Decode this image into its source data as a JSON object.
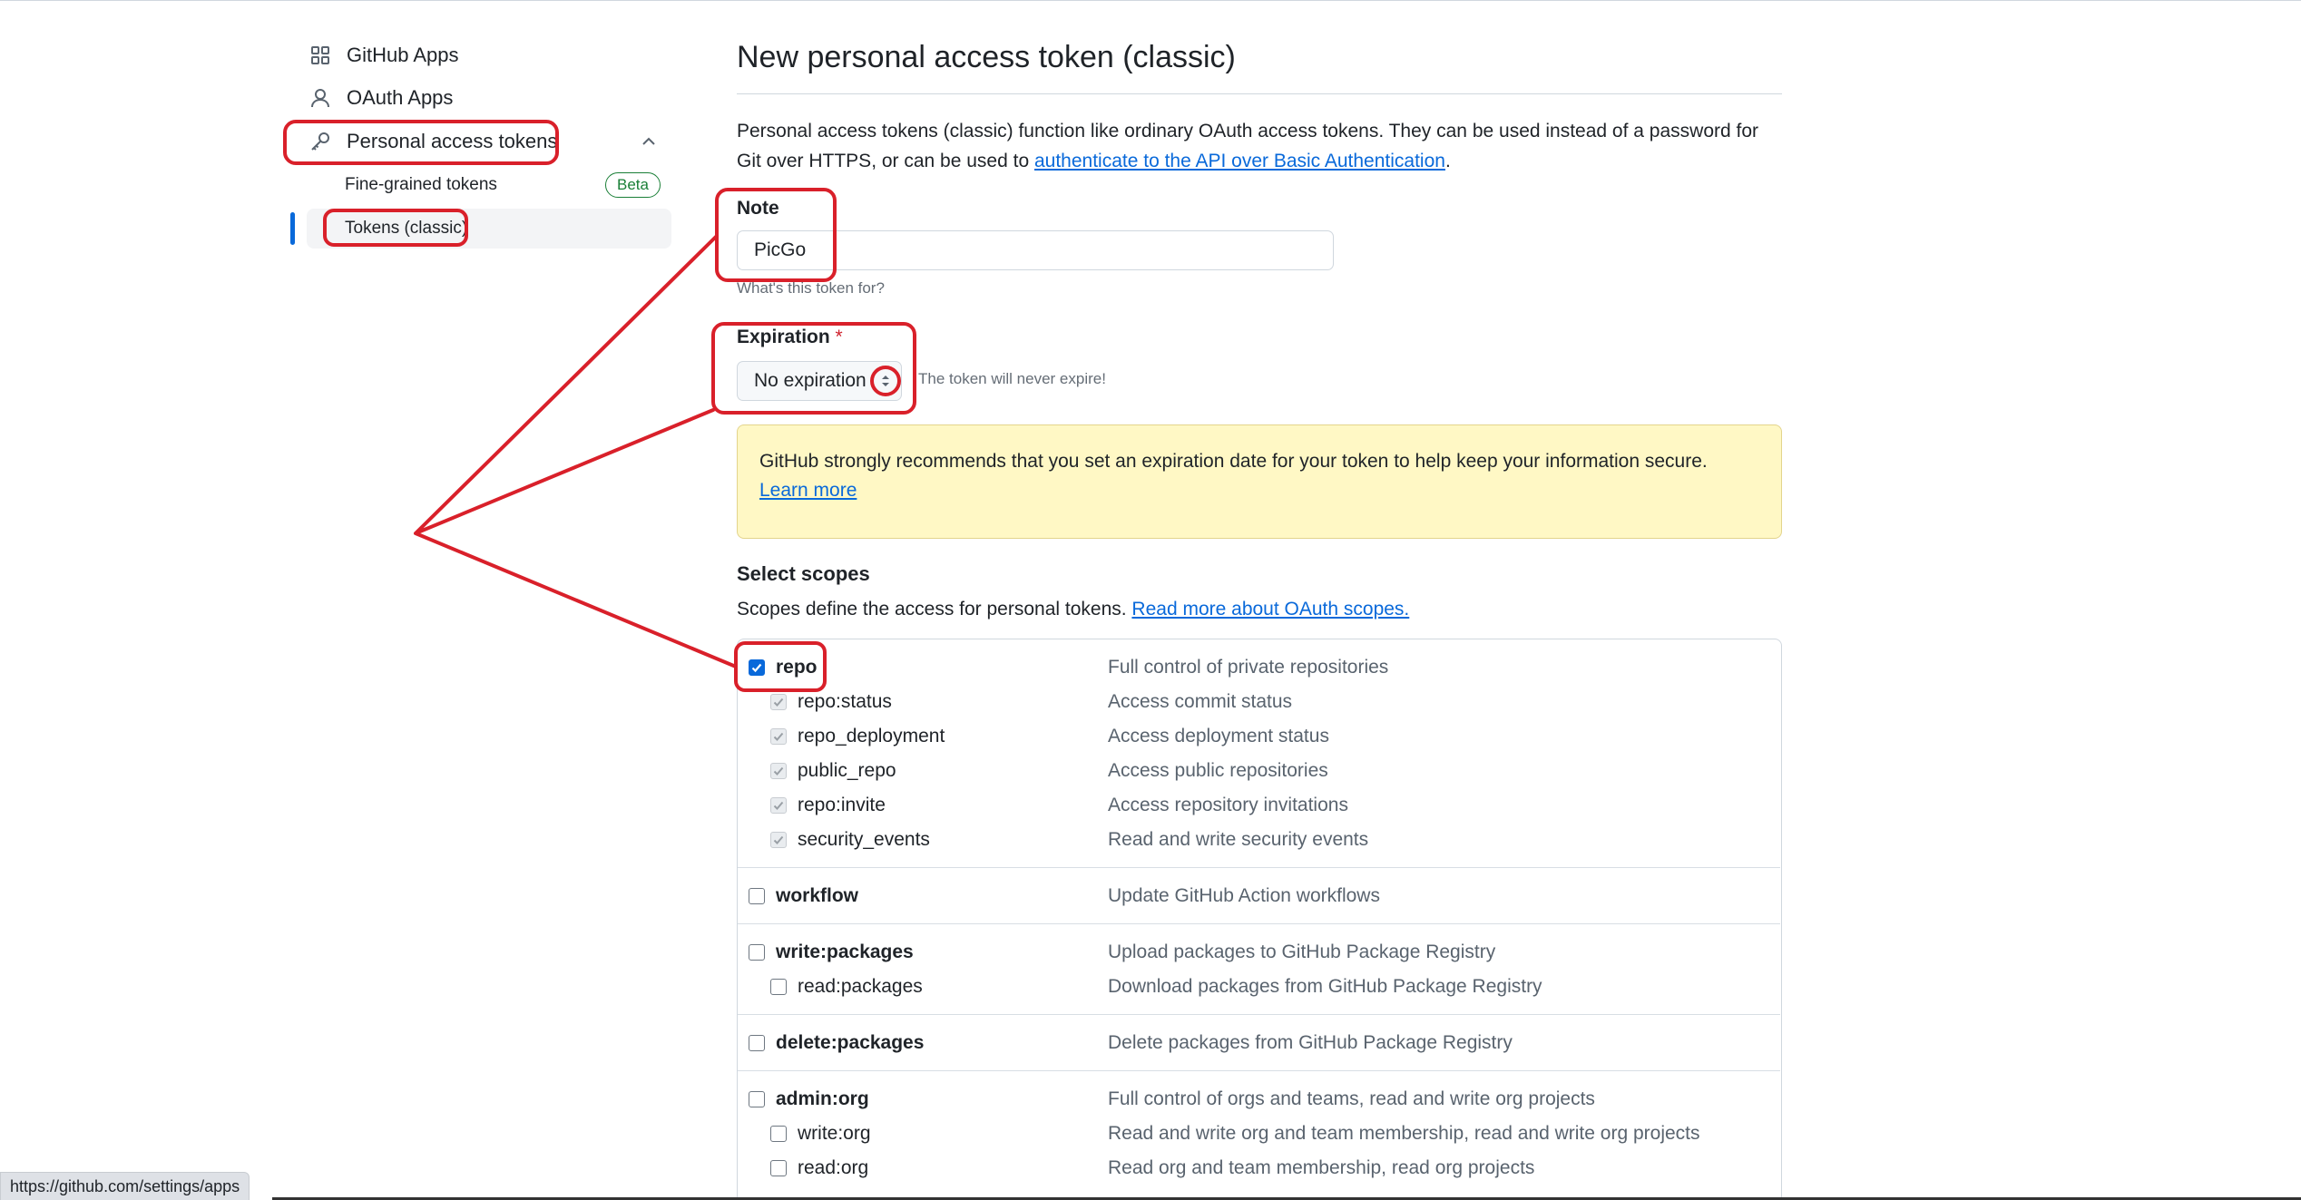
{
  "sidebar": {
    "items": [
      {
        "label": "GitHub Apps",
        "icon": "apps-grid-icon"
      },
      {
        "label": "OAuth Apps",
        "icon": "person-icon"
      },
      {
        "label": "Personal access tokens",
        "icon": "key-icon"
      }
    ],
    "sub_items": [
      {
        "label": "Fine-grained tokens",
        "badge": "Beta"
      },
      {
        "label": "Tokens (classic)"
      }
    ]
  },
  "main": {
    "title": "New personal access token (classic)",
    "intro_text": "Personal access tokens (classic) function like ordinary OAuth access tokens. They can be used instead of a password for Git over HTTPS, or can be used to ",
    "intro_link": "authenticate to the API over Basic Authentication",
    "intro_end": ".",
    "note": {
      "label": "Note",
      "value": "PicGo",
      "hint": "What's this token for?"
    },
    "expiration": {
      "label": "Expiration",
      "required_mark": "*",
      "selected": "No expiration",
      "hint": "The token will never expire!"
    },
    "warning": {
      "text": "GitHub strongly recommends that you set an expiration date for your token to help keep your information secure.",
      "link": "Learn more"
    },
    "scopes": {
      "heading": "Select scopes",
      "description": "Scopes define the access for personal tokens. ",
      "description_link": "Read more about OAuth scopes.",
      "rows": [
        {
          "name": "repo",
          "desc": "Full control of private repositories",
          "checked": true
        },
        {
          "name": "repo:status",
          "desc": "Access commit status",
          "checked": true
        },
        {
          "name": "repo_deployment",
          "desc": "Access deployment status",
          "checked": true
        },
        {
          "name": "public_repo",
          "desc": "Access public repositories",
          "checked": true
        },
        {
          "name": "repo:invite",
          "desc": "Access repository invitations",
          "checked": true
        },
        {
          "name": "security_events",
          "desc": "Read and write security events",
          "checked": true
        },
        {
          "name": "workflow",
          "desc": "Update GitHub Action workflows",
          "checked": false
        },
        {
          "name": "write:packages",
          "desc": "Upload packages to GitHub Package Registry",
          "checked": false
        },
        {
          "name": "read:packages",
          "desc": "Download packages from GitHub Package Registry",
          "checked": false
        },
        {
          "name": "delete:packages",
          "desc": "Delete packages from GitHub Package Registry",
          "checked": false
        },
        {
          "name": "admin:org",
          "desc": "Full control of orgs and teams, read and write org projects",
          "checked": false
        },
        {
          "name": "write:org",
          "desc": "Read and write org and team membership, read and write org projects",
          "checked": false
        },
        {
          "name": "read:org",
          "desc": "Read org and team membership, read org projects",
          "checked": false
        }
      ]
    }
  },
  "status_bar": {
    "url": "https://github.com/settings/apps"
  },
  "colors": {
    "annotation": "#d9202a",
    "accent": "#0969da",
    "warning_bg": "#fff8c5",
    "beta_green": "#1a7f37"
  }
}
